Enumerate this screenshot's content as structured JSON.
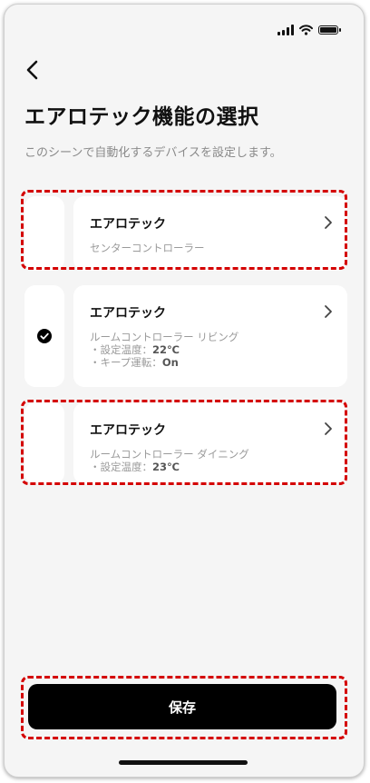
{
  "header": {
    "title": "エアロテック機能の選択",
    "description": "このシーンで自動化するデバイスを設定します。"
  },
  "devices": [
    {
      "name": "エアロテック",
      "subtitle": "センターコントローラー",
      "details": [],
      "selected": false,
      "highlighted": true
    },
    {
      "name": "エアロテック",
      "subtitle": "ルームコントローラー リビング",
      "details": [
        {
          "label": "・設定温度：",
          "value": "22℃"
        },
        {
          "label": "・キープ運転：",
          "value": "On"
        }
      ],
      "selected": true,
      "highlighted": false
    },
    {
      "name": "エアロテック",
      "subtitle": "ルームコントローラー ダイニング",
      "details": [
        {
          "label": "・設定温度：",
          "value": "23℃"
        }
      ],
      "selected": false,
      "highlighted": true
    }
  ],
  "footer": {
    "save_label": "保存"
  },
  "colors": {
    "accent": "#000000",
    "highlight": "#d40000",
    "background": "#f5f5f5"
  },
  "icons": [
    "back-arrow-icon",
    "chevron-right-icon",
    "check-circle-icon",
    "signal-icon",
    "wifi-icon",
    "battery-icon"
  ]
}
